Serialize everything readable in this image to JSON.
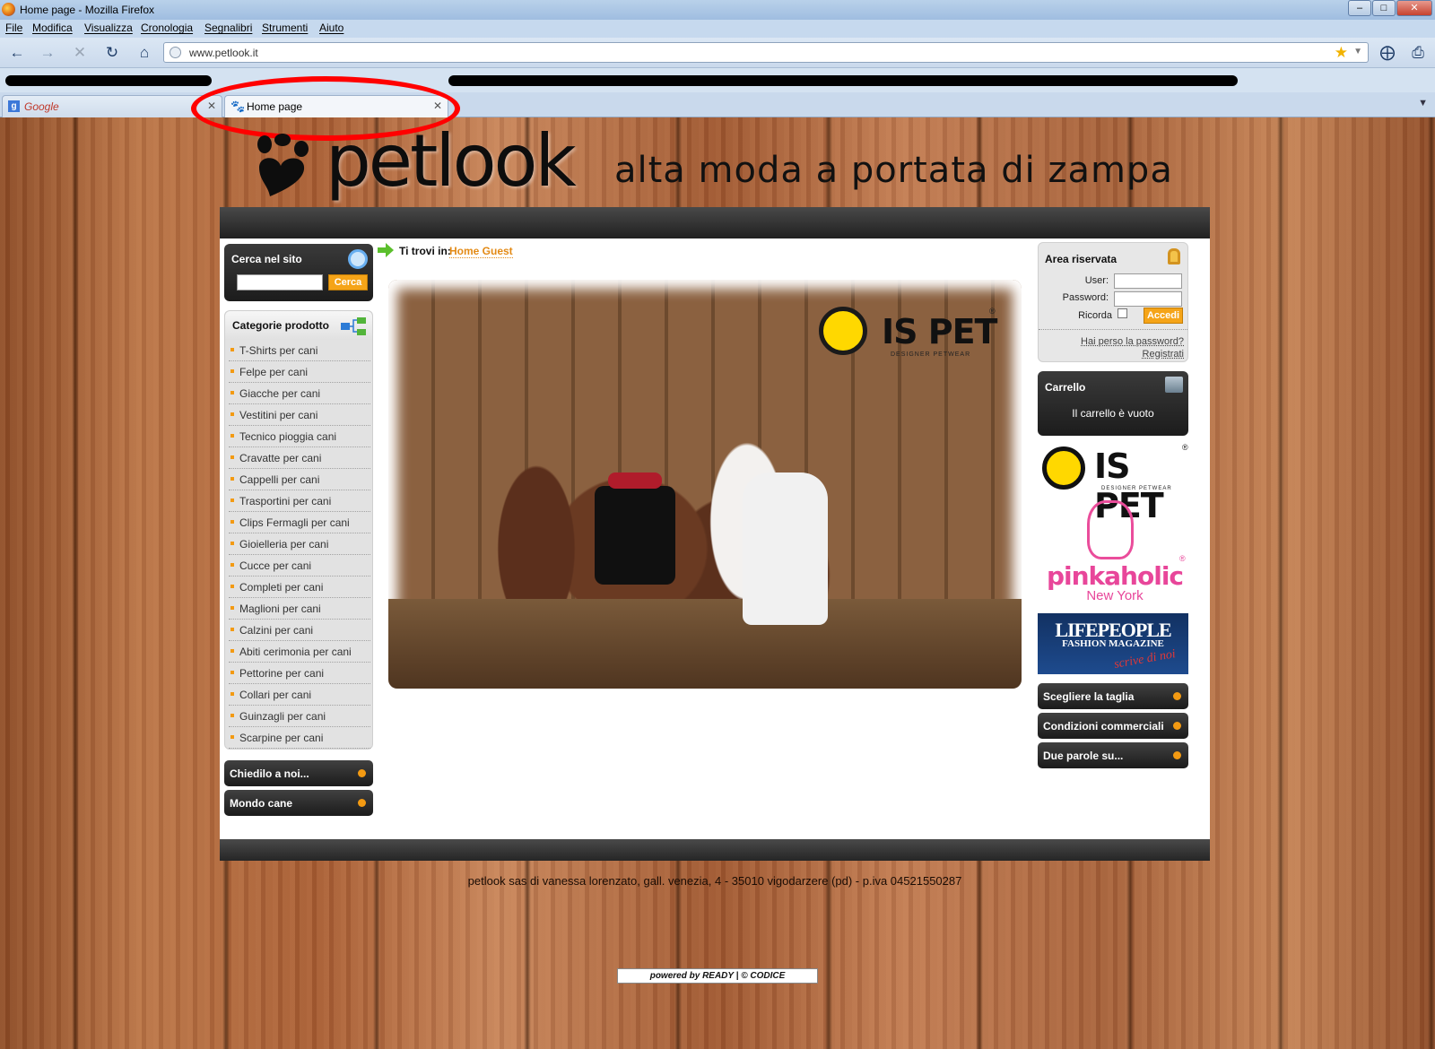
{
  "window": {
    "title": "Home page - Mozilla Firefox",
    "buttons": [
      "–",
      "□",
      "✕"
    ]
  },
  "menu": [
    "File",
    "Modifica",
    "Visualizza",
    "Cronologia",
    "Segnalibri",
    "Strumenti",
    "Aiuto"
  ],
  "address": {
    "url": "www.petlook.it"
  },
  "tabs": [
    {
      "label": "Google"
    },
    {
      "label": "Home page"
    }
  ],
  "brand": {
    "name": "petlook",
    "tagline": "alta moda a portata di zampa"
  },
  "search": {
    "title": "Cerca nel sito",
    "button": "Cerca",
    "value": ""
  },
  "categories": {
    "title": "Categorie prodotto",
    "items": [
      "T-Shirts per cani",
      "Felpe per cani",
      "Giacche per cani",
      "Vestitini per cani",
      "Tecnico pioggia cani",
      "Cravatte per cani",
      "Cappelli per cani",
      "Trasportini per cani",
      "Clips Fermagli per cani",
      "Gioielleria per cani",
      "Cucce per cani",
      "Completi per cani",
      "Maglioni per cani",
      "Calzini per cani",
      "Abiti cerimonia per cani",
      "Pettorine per cani",
      "Collari per cani",
      "Guinzagli per cani",
      "Scarpine per cani"
    ]
  },
  "left_links": [
    "Chiedilo a noi...",
    "Mondo cane"
  ],
  "breadcrumb": {
    "prefix": "Ti trovi in:",
    "current": "Home Guest"
  },
  "hero": {
    "brand": "IS PET",
    "sub": "DESIGNER PETWEAR",
    "reg": "®"
  },
  "login": {
    "title": "Area riservata",
    "user_label": "User:",
    "password_label": "Password:",
    "remember_label": "Ricorda",
    "button": "Accedi",
    "forgot": "Hai perso la password?",
    "register": "Registrati"
  },
  "cart": {
    "title": "Carrello",
    "message": "Il carrello è vuoto"
  },
  "sponsors": {
    "ispet": {
      "name": "IS PET",
      "sub": "DESIGNER PETWEAR",
      "reg": "®"
    },
    "pinkaholic": {
      "name": "pinkaholic",
      "city": "New York",
      "reg": "®"
    },
    "lifepeople": {
      "name": "LIFEPEOPLE",
      "sub": "FASHION MAGAZINE",
      "note": "scrive di noi"
    }
  },
  "right_links": [
    "Scegliere la taglia",
    "Condizioni commerciali",
    "Due parole su..."
  ],
  "footer": {
    "text": "petlook sas di vanessa lorenzato, gall. venezia, 4 - 35010 vigodarzere (pd) - p.iva 04521550287",
    "powered": "powered by READY | © CODICE"
  }
}
